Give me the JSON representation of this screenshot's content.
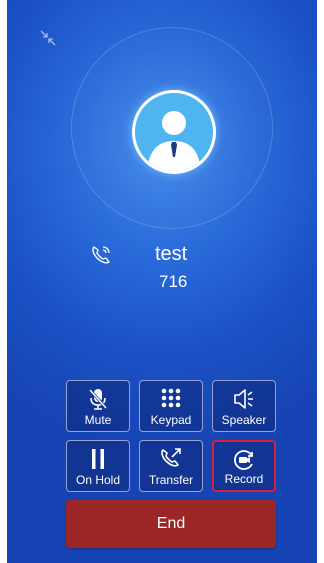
{
  "caller": {
    "name": "test",
    "number": "716"
  },
  "controls": {
    "mute_label": "Mute",
    "keypad_label": "Keypad",
    "speaker_label": "Speaker",
    "hold_label": "On Hold",
    "transfer_label": "Transfer",
    "record_label": "Record",
    "selected": "Record"
  },
  "end_label": "End",
  "colors": {
    "background": "#1e58cc",
    "end_button": "#9c2626",
    "selected_border": "#d8223a",
    "avatar": "#4fb5f0"
  },
  "icons": [
    "minimize-icon",
    "avatar-person-icon",
    "incoming-call-icon",
    "mic-off-icon",
    "keypad-icon",
    "speaker-icon",
    "pause-icon",
    "transfer-call-icon",
    "record-icon"
  ]
}
